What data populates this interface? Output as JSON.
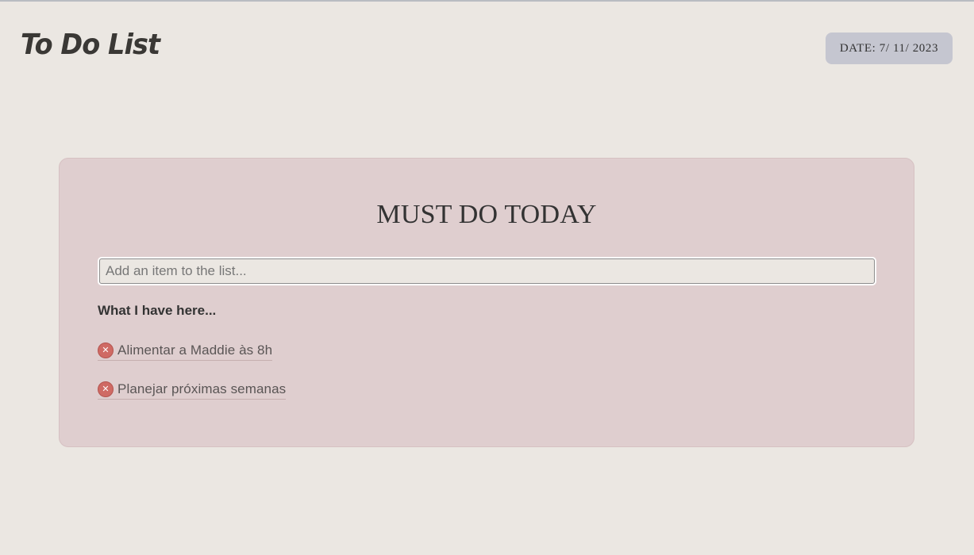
{
  "app": {
    "title": "To Do List"
  },
  "header": {
    "date_label": "DATE: 7/ 11/ 2023"
  },
  "card": {
    "title": "MUST DO TODAY",
    "input": {
      "placeholder": "Add an item to the list...",
      "value": ""
    },
    "list_heading": "What I have here...",
    "items": [
      {
        "label": "Alimentar a Maddie às 8h",
        "remove_icon": "close-icon"
      },
      {
        "label": "Planejar próximas semanas",
        "remove_icon": "close-icon"
      }
    ]
  },
  "colors": {
    "page_background": "#ebe7e2",
    "card_background": "#dfcecf",
    "date_badge": "#c5c6d0",
    "remove_button": "#cf6a64",
    "text": "#333333"
  }
}
